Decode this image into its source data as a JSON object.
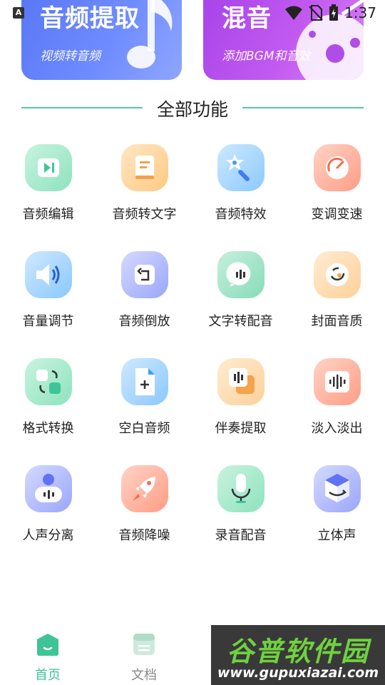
{
  "status_bar": {
    "badge": "A",
    "time": "1:37",
    "icons": [
      "wifi-icon",
      "no-sim-icon",
      "battery-charging-icon"
    ]
  },
  "banners": [
    {
      "title": "音频提取",
      "subtitle": "视频转音频",
      "icon": "music-note-icon",
      "color": "#5a78f5"
    },
    {
      "title": "混音",
      "subtitle": "添加BGM和音效",
      "icon": "vinyl-record-icon",
      "color": "#a845ea"
    }
  ],
  "section": {
    "title": "全部功能",
    "line_color": "#4fcca0"
  },
  "features": [
    {
      "label": "音频编辑",
      "icon": "play-edit-icon",
      "color": "#5ed3a4"
    },
    {
      "label": "音频转文字",
      "icon": "document-icon",
      "color": "#f5a64c"
    },
    {
      "label": "音频特效",
      "icon": "magic-wand-icon",
      "color": "#47a6f5"
    },
    {
      "label": "变调变速",
      "icon": "speedometer-icon",
      "color": "#f56b4e"
    },
    {
      "label": "音量调节",
      "icon": "speaker-icon",
      "color": "#3f9cf5"
    },
    {
      "label": "音频倒放",
      "icon": "reverse-icon",
      "color": "#6172f2"
    },
    {
      "label": "文字转配音",
      "icon": "voice-bubble-icon",
      "color": "#3ec496"
    },
    {
      "label": "封面音质",
      "icon": "quality-dial-icon",
      "color": "#f5a34c"
    },
    {
      "label": "格式转换",
      "icon": "convert-icon",
      "color": "#3ec496"
    },
    {
      "label": "空白音频",
      "icon": "new-file-icon",
      "color": "#3f9cf5"
    },
    {
      "label": "伴奏提取",
      "icon": "layers-waveform-icon",
      "color": "#f5a34c"
    },
    {
      "label": "淡入淡出",
      "icon": "waveform-icon",
      "color": "#f56b4e"
    },
    {
      "label": "人声分离",
      "icon": "person-voice-icon",
      "color": "#6172f2"
    },
    {
      "label": "音频降噪",
      "icon": "rocket-icon",
      "color": "#f56b4e"
    },
    {
      "label": "录音配音",
      "icon": "microphone-icon",
      "color": "#3ec496"
    },
    {
      "label": "立体声",
      "icon": "cube-3d-icon",
      "color": "#6172f2"
    }
  ],
  "bottom_nav": [
    {
      "label": "首页",
      "icon": "home-icon",
      "active": true
    },
    {
      "label": "文档",
      "icon": "document-list-icon",
      "active": false
    }
  ],
  "watermark": {
    "title": "谷普软件园",
    "url": "www.gupuxiazai.com"
  }
}
